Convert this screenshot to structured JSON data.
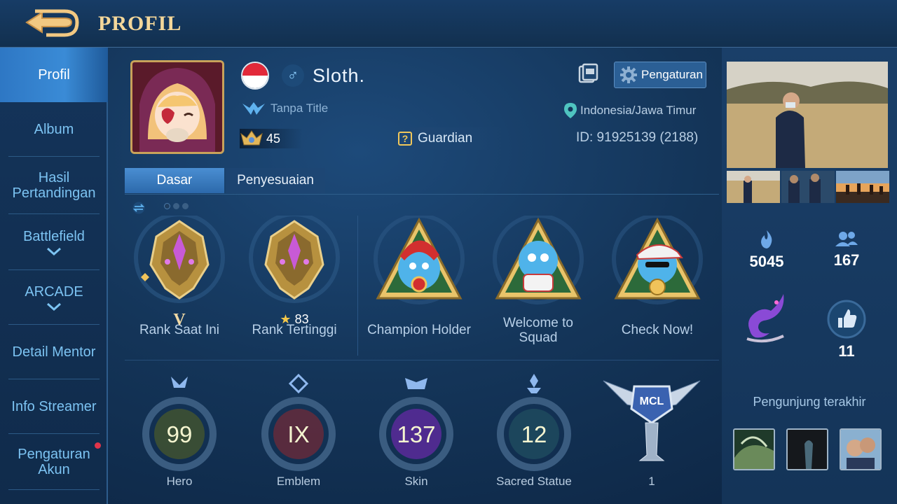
{
  "header": {
    "title": "PROFIL",
    "back_icon": "back-arrow-icon"
  },
  "sidebar": {
    "items": [
      {
        "label": "Profil",
        "active": true
      },
      {
        "label": "Album"
      },
      {
        "label": "Hasil Pertandingan"
      },
      {
        "label": "Battlefield",
        "expandable": true
      },
      {
        "label": "ARCADE",
        "expandable": true
      },
      {
        "label": "Detail Mentor"
      },
      {
        "label": "Info Streamer"
      },
      {
        "label": "Pengaturan Akun",
        "notification": true
      }
    ]
  },
  "profile": {
    "name": "Sloth.",
    "gender_symbol": "♂",
    "title": "Tanpa Title",
    "level": "45",
    "role": "Guardian",
    "location": "Indonesia/Jawa Timur",
    "id_text": "ID: 91925139 (2188)",
    "settings_label": "Pengaturan"
  },
  "tabs": [
    "Dasar",
    "Penyesuaian"
  ],
  "achievements": [
    {
      "label": "Rank Saat Ini",
      "sub": "V"
    },
    {
      "label": "Rank Tertinggi",
      "sub": "83"
    },
    {
      "label": "Champion Holder"
    },
    {
      "label": "Welcome to Squad"
    },
    {
      "label": "Check Now!"
    }
  ],
  "stats": [
    {
      "label": "Hero",
      "value": "99",
      "color": "#c4a93a"
    },
    {
      "label": "Emblem",
      "value": "IX",
      "color": "#a8374a"
    },
    {
      "label": "Skin",
      "value": "137",
      "color": "#6a3fb3"
    },
    {
      "label": "Sacred Statue",
      "value": "12",
      "color": "#2e5f7a"
    },
    {
      "label": "1",
      "value": "MCL"
    }
  ],
  "right_panel": {
    "popularity": "5045",
    "followers": "167",
    "likes": "11",
    "recent_visitors_label": "Pengunjung terakhir"
  },
  "colors": {
    "accent": "#f4d79a",
    "sidebar_text": "#7cc3f2",
    "active_tab": "#3a8bd6"
  }
}
